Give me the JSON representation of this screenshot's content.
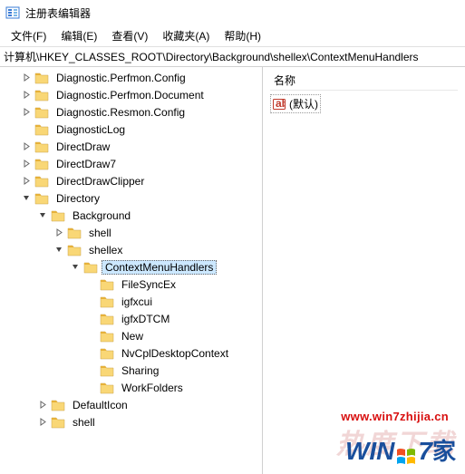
{
  "window": {
    "title": "注册表编辑器"
  },
  "menu": {
    "file": "文件(F)",
    "edit": "编辑(E)",
    "view": "查看(V)",
    "favorites": "收藏夹(A)",
    "help": "帮助(H)"
  },
  "path": "计算机\\HKEY_CLASSES_ROOT\\Directory\\Background\\shellex\\ContextMenuHandlers",
  "list": {
    "header_name": "名称",
    "default_value": "(默认)"
  },
  "tree": [
    {
      "d": 1,
      "exp": "closed",
      "label": "Diagnostic.Perfmon.Config"
    },
    {
      "d": 1,
      "exp": "closed",
      "label": "Diagnostic.Perfmon.Document"
    },
    {
      "d": 1,
      "exp": "closed",
      "label": "Diagnostic.Resmon.Config"
    },
    {
      "d": 1,
      "exp": "none",
      "label": "DiagnosticLog"
    },
    {
      "d": 1,
      "exp": "closed",
      "label": "DirectDraw"
    },
    {
      "d": 1,
      "exp": "closed",
      "label": "DirectDraw7"
    },
    {
      "d": 1,
      "exp": "closed",
      "label": "DirectDrawClipper"
    },
    {
      "d": 1,
      "exp": "open",
      "label": "Directory"
    },
    {
      "d": 2,
      "exp": "open",
      "label": "Background"
    },
    {
      "d": 3,
      "exp": "closed",
      "label": "shell"
    },
    {
      "d": 3,
      "exp": "open",
      "label": "shellex"
    },
    {
      "d": 4,
      "exp": "open",
      "label": "ContextMenuHandlers",
      "selected": true
    },
    {
      "d": 5,
      "exp": "none",
      "label": " FileSyncEx"
    },
    {
      "d": 5,
      "exp": "none",
      "label": "igfxcui"
    },
    {
      "d": 5,
      "exp": "none",
      "label": "igfxDTCM"
    },
    {
      "d": 5,
      "exp": "none",
      "label": "New"
    },
    {
      "d": 5,
      "exp": "none",
      "label": "NvCplDesktopContext"
    },
    {
      "d": 5,
      "exp": "none",
      "label": "Sharing"
    },
    {
      "d": 5,
      "exp": "none",
      "label": "WorkFolders"
    },
    {
      "d": 2,
      "exp": "closed",
      "label": "DefaultIcon"
    },
    {
      "d": 2,
      "exp": "closed",
      "label": "shell"
    }
  ],
  "watermark": {
    "url": "www.win7zhijia.cn",
    "bg_text": "热度下载",
    "logo_win": "WIN",
    "logo_seven": "7",
    "logo_home": "家"
  },
  "icons": {
    "folder_fill": "#f9d776",
    "folder_tab": "#e6b13a"
  }
}
